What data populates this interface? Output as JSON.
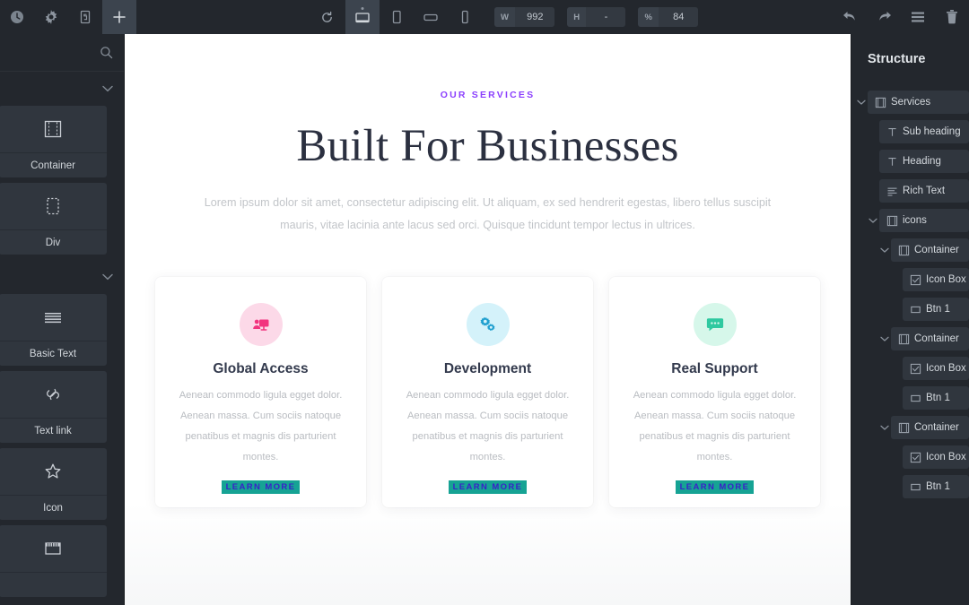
{
  "toolbar": {
    "left_icons": [
      {
        "name": "history-clock-icon",
        "label": "History"
      },
      {
        "name": "settings-gear-icon",
        "label": "Page Settings"
      },
      {
        "name": "css-style-icon",
        "label": "Style Manager"
      },
      {
        "name": "add-plus-icon",
        "label": "Add Element"
      }
    ],
    "refresh_label": "Refresh",
    "devices": [
      {
        "name": "desktop-icon",
        "label": "Desktop",
        "active": true
      },
      {
        "name": "tablet-icon",
        "label": "Tablet",
        "active": false
      },
      {
        "name": "mobile-landscape-icon",
        "label": "Mobile Landscape",
        "active": false
      },
      {
        "name": "mobile-portrait-icon",
        "label": "Mobile Portrait",
        "active": false
      }
    ],
    "fields": [
      {
        "label": "W",
        "value": "992"
      },
      {
        "label": "H",
        "value": "-"
      },
      {
        "label": "%",
        "value": "84"
      }
    ],
    "right_icons": [
      {
        "name": "undo-icon",
        "label": "Undo"
      },
      {
        "name": "redo-icon",
        "label": "Redo"
      },
      {
        "name": "hamburger-menu-icon",
        "label": "Menu"
      },
      {
        "name": "trash-icon",
        "label": "Delete"
      }
    ]
  },
  "left_panel": {
    "search_placeholder": "Search",
    "elements": [
      {
        "label": "Container",
        "icon": "container-icon"
      },
      {
        "label": "Div",
        "icon": "div-block-icon"
      },
      {
        "label": "Basic Text",
        "icon": "basic-text-icon"
      },
      {
        "label": "Text link",
        "icon": "link-icon"
      },
      {
        "label": "Icon",
        "icon": "star-icon"
      },
      {
        "label": "",
        "icon": "video-icon"
      }
    ]
  },
  "canvas": {
    "eyebrow": "OUR SERVICES",
    "heading": "Built For Businesses",
    "lede": "Lorem ipsum dolor sit amet, consectetur adipiscing elit. Ut aliquam, ex sed hendrerit egestas, libero tellus suscipit mauris, vitae lacinia ante lacus sed orci. Quisque tincidunt tempor lectus in ultrices.",
    "cards": [
      {
        "title": "Global Access",
        "body": "Aenean commodo ligula egget dolor. Aenean massa. Cum sociis natoque penatibus et magnis dis parturient montes.",
        "cta": "LEARN MORE",
        "icon": "presentation-person-icon",
        "icon_bg": "#fcd9e8",
        "icon_color": "#f2357f"
      },
      {
        "title": "Development",
        "body": "Aenean commodo ligula egget dolor. Aenean massa. Cum sociis natoque penatibus et magnis dis parturient montes.",
        "cta": "LEARN MORE",
        "icon": "gears-icon",
        "icon_bg": "#d4f2fa",
        "icon_color": "#1f9fcf"
      },
      {
        "title": "Real Support",
        "body": "Aenean commodo ligula egget dolor. Aenean massa. Cum sociis natoque penatibus et magnis dis parturient montes.",
        "cta": "LEARN MORE",
        "icon": "chat-bubble-icon",
        "icon_bg": "#d6f7ea",
        "icon_color": "#2fc9a0"
      }
    ],
    "accent_purple": "#8b3ffd",
    "cta_bg": "#16a394",
    "cta_text_color": "#3a22c8"
  },
  "right_panel": {
    "title": "Structure",
    "tree": [
      {
        "label": "Services",
        "icon": "container-icon",
        "caret": true,
        "indent": 0
      },
      {
        "label": "Sub heading",
        "icon": "text-icon",
        "caret": false,
        "indent": 1
      },
      {
        "label": "Heading",
        "icon": "text-icon",
        "caret": false,
        "indent": 1
      },
      {
        "label": "Rich Text",
        "icon": "rich-text-icon",
        "caret": false,
        "indent": 1
      },
      {
        "label": "icons",
        "icon": "container-icon",
        "caret": true,
        "indent": 1
      },
      {
        "label": "Container",
        "icon": "container-icon",
        "caret": true,
        "indent": 2
      },
      {
        "label": "Icon Box",
        "icon": "icon-box-icon",
        "caret": false,
        "indent": 3
      },
      {
        "label": "Btn 1",
        "icon": "button-icon",
        "caret": false,
        "indent": 3
      },
      {
        "label": "Container",
        "icon": "container-icon",
        "caret": true,
        "indent": 2
      },
      {
        "label": "Icon Box",
        "icon": "icon-box-icon",
        "caret": false,
        "indent": 3
      },
      {
        "label": "Btn 1",
        "icon": "button-icon",
        "caret": false,
        "indent": 3
      },
      {
        "label": "Container",
        "icon": "container-icon",
        "caret": true,
        "indent": 2
      },
      {
        "label": "Icon Box",
        "icon": "icon-box-icon",
        "caret": false,
        "indent": 3
      },
      {
        "label": "Btn 1",
        "icon": "button-icon",
        "caret": false,
        "indent": 3
      }
    ]
  }
}
